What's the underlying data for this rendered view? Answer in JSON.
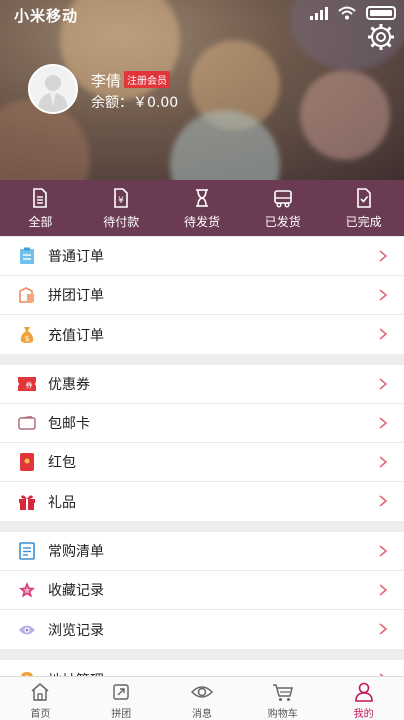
{
  "status_bar": {
    "carrier": "小米移动"
  },
  "profile": {
    "name": "李倩",
    "member_badge": "注册会员",
    "balance": "余额：￥0.00"
  },
  "order_tabs": [
    {
      "label": "全部",
      "icon": "document-icon"
    },
    {
      "label": "待付款",
      "icon": "yuan-document-icon"
    },
    {
      "label": "待发货",
      "icon": "hourglass-icon"
    },
    {
      "label": "已发货",
      "icon": "truck-icon"
    },
    {
      "label": "已完成",
      "icon": "check-document-icon"
    }
  ],
  "groups": [
    [
      {
        "label": "普通订单",
        "icon": "clipboard-icon"
      },
      {
        "label": "拼团订单",
        "icon": "group-tag-icon"
      },
      {
        "label": "充值订单",
        "icon": "money-bag-icon"
      }
    ],
    [
      {
        "label": "优惠券",
        "icon": "coupon-icon"
      },
      {
        "label": "包邮卡",
        "icon": "card-wallet-icon"
      },
      {
        "label": "红包",
        "icon": "red-envelope-icon"
      },
      {
        "label": "礼品",
        "icon": "gift-icon"
      }
    ],
    [
      {
        "label": "常购清单",
        "icon": "list-icon"
      },
      {
        "label": "收藏记录",
        "icon": "star-icon"
      },
      {
        "label": "浏览记录",
        "icon": "eye-icon"
      }
    ],
    [
      {
        "label": "地址管理",
        "icon": "location-icon"
      }
    ]
  ],
  "tabbar": [
    {
      "label": "首页",
      "icon": "home-icon"
    },
    {
      "label": "拼团",
      "icon": "group-buy-icon"
    },
    {
      "label": "消息",
      "icon": "eye-message-icon"
    },
    {
      "label": "购物车",
      "icon": "cart-icon"
    },
    {
      "label": "我的",
      "icon": "person-icon",
      "active": true
    }
  ],
  "colors": {
    "accent": "#c2185b",
    "order_bar": "#6b3b54",
    "chevron": "#e26a76"
  }
}
